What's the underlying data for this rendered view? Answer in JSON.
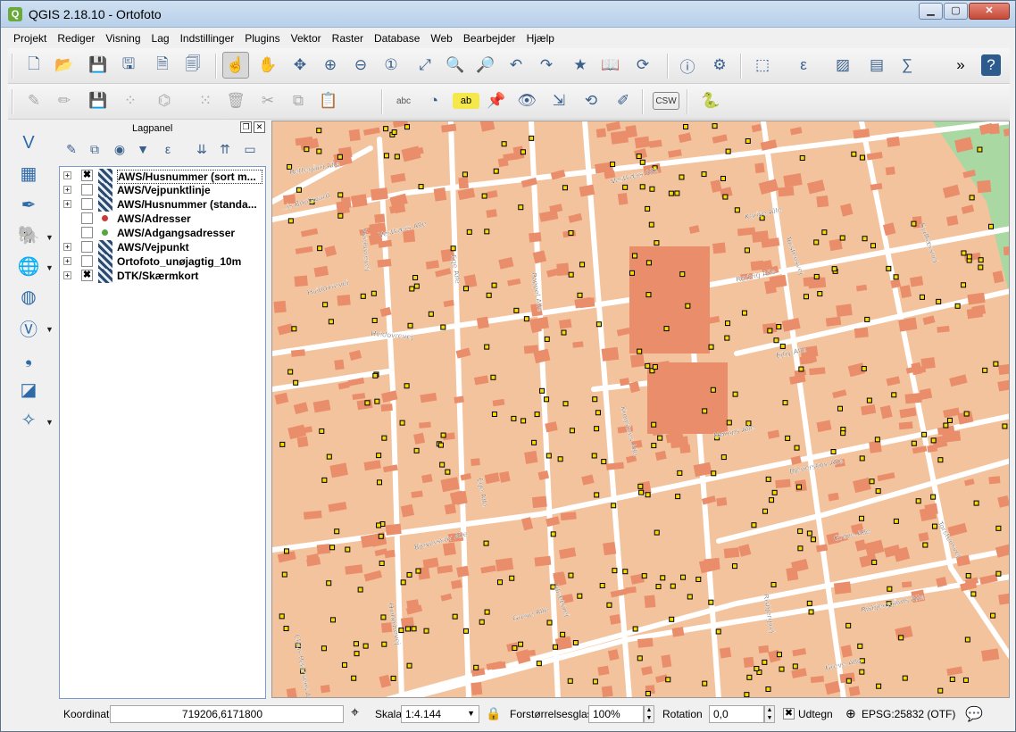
{
  "window": {
    "title": "QGIS 2.18.10 - Ortofoto",
    "app_icon": "Q"
  },
  "menu": [
    "Projekt",
    "Rediger",
    "Visning",
    "Lag",
    "Indstillinger",
    "Plugins",
    "Vektor",
    "Raster",
    "Database",
    "Web",
    "Bearbejder",
    "Hjælp"
  ],
  "toolbar1": [
    "new-project-icon",
    "open-project-icon",
    "save-project-icon",
    "save-as-icon",
    "new-print-composer-icon",
    "composer-manager-icon",
    "touch-pan-icon",
    "pan-hand-icon",
    "pan-to-selection-icon",
    "zoom-in-icon",
    "zoom-out-icon",
    "zoom-native-icon",
    "zoom-full-icon",
    "zoom-selection-icon",
    "zoom-layer-icon",
    "zoom-last-icon",
    "zoom-next-icon",
    "new-bookmark-icon",
    "show-bookmarks-icon",
    "refresh-icon",
    "identify-icon",
    "measure-icon",
    "select-features-icon",
    "field-calculator-icon",
    "deselect-icon",
    "attribute-table-icon",
    "statistics-icon"
  ],
  "toolbar1_labels": {
    "more": "»",
    "help": "?"
  },
  "toolbar2": [
    "current-edits-icon",
    "toggle-editing-icon",
    "save-edits-icon",
    "add-feature-icon",
    "node-tool-icon",
    "move-feature-icon",
    "delete-selected-icon",
    "cut-features-icon",
    "copy-features-icon",
    "paste-features-icon",
    "label-abc-icon",
    "layer-diagram-icon",
    "label-highlight-icon",
    "pin-label-icon",
    "show-hide-label-icon",
    "move-label-icon",
    "rotate-label-icon",
    "change-label-icon",
    "csw-icon",
    "python-console-icon"
  ],
  "toolbar2_labels": {
    "abc": "abc",
    "csw": "CSW",
    "ab": "ab"
  },
  "left_tools": [
    "add-vector-layer-icon",
    "add-raster-layer-icon",
    "add-spatialite-icon",
    "add-postgis-icon",
    "add-wms-icon",
    "add-wcs-icon",
    "add-wfs-icon",
    "add-delimited-text-icon",
    "add-virtual-layer-icon",
    "new-shapefile-icon"
  ],
  "layers_panel": {
    "title": "Lagpanel",
    "layers": [
      {
        "name": "AWS/Husnummer (sort m...",
        "checked": true,
        "symbol": "raster",
        "expand": "+"
      },
      {
        "name": "AWS/Vejpunktlinje",
        "checked": false,
        "symbol": "raster",
        "expand": "+"
      },
      {
        "name": "AWS/Husnummer (standa...",
        "checked": false,
        "symbol": "raster",
        "expand": "+"
      },
      {
        "name": "AWS/Adresser",
        "checked": false,
        "symbol": "dot",
        "symbol_color": "#c93b3b",
        "expand": ""
      },
      {
        "name": "AWS/Adgangsadresser",
        "checked": false,
        "symbol": "dot",
        "symbol_color": "#57a646",
        "expand": ""
      },
      {
        "name": "AWS/Vejpunkt",
        "checked": false,
        "symbol": "raster",
        "expand": "+"
      },
      {
        "name": "Ortofoto_unøjagtig_10m",
        "checked": false,
        "symbol": "raster",
        "expand": "+"
      },
      {
        "name": "DTK/Skærmkort",
        "checked": true,
        "symbol": "raster",
        "expand": "+"
      }
    ]
  },
  "map": {
    "colors": {
      "land": "#f2c39d",
      "building": "#e98d6a",
      "road": "#ffffff",
      "green": "#a9d8a3",
      "marker": "#f5d90a"
    },
    "street_labels": [
      "Vestkærs Alle",
      "Vestkærs Alle",
      "Karise Alle",
      "Sydkærsvej",
      "Torstensvej",
      "Rødvig Alle",
      "Ejby Alle",
      "Hvidovrevej",
      "Ege Alle",
      "Poppel Alle",
      "Krogstens Alle",
      "Ege Alle",
      "Mørups Alle",
      "Bjeverskov Alle",
      "Bjeverskov Alle",
      "Torstensvej",
      "Greve Alle",
      "Idrætsvej",
      "Risbjergvej",
      "Greve Alle",
      "Risbjerggårds Alle",
      "Claus Petersens Alle",
      "Hvidovrevej",
      "Hvidovrevej",
      "Hvidovrevej",
      "Rettegård Alle",
      "...is Boulevard",
      "Greve Alle"
    ]
  },
  "status": {
    "coord_label": "Koordinat",
    "coord_value": "719206,6171800",
    "scale_label": "Skala",
    "scale_value": "1:4.144",
    "magnifier_label": "Forstørrelsesglas",
    "magnifier_value": "100%",
    "rotation_label": "Rotation",
    "rotation_value": "0,0",
    "render_label": "Udtegn",
    "crs_label": "EPSG:25832 (OTF)"
  }
}
